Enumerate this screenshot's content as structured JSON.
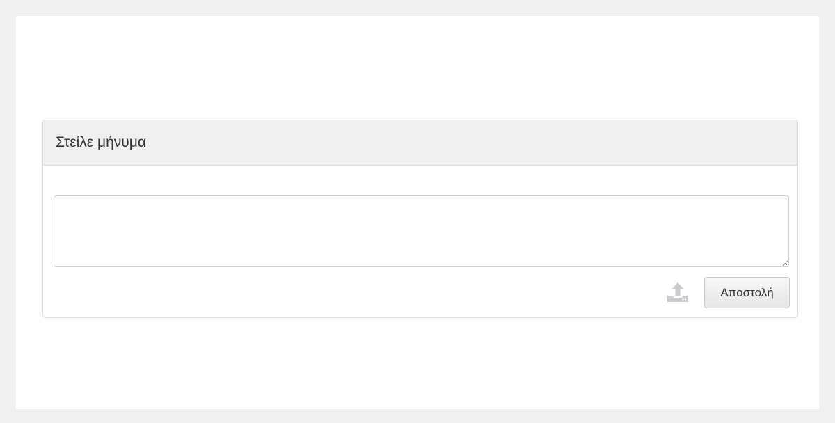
{
  "panel": {
    "title": "Στείλε μήνυμα"
  },
  "message": {
    "value": "",
    "placeholder": ""
  },
  "actions": {
    "upload_icon": "upload-icon",
    "send_label": "Αποστολή"
  },
  "colors": {
    "page_background": "#f0f0f0",
    "panel_heading_background": "#f0f0f0",
    "upload_icon": "#c9c9d0"
  }
}
